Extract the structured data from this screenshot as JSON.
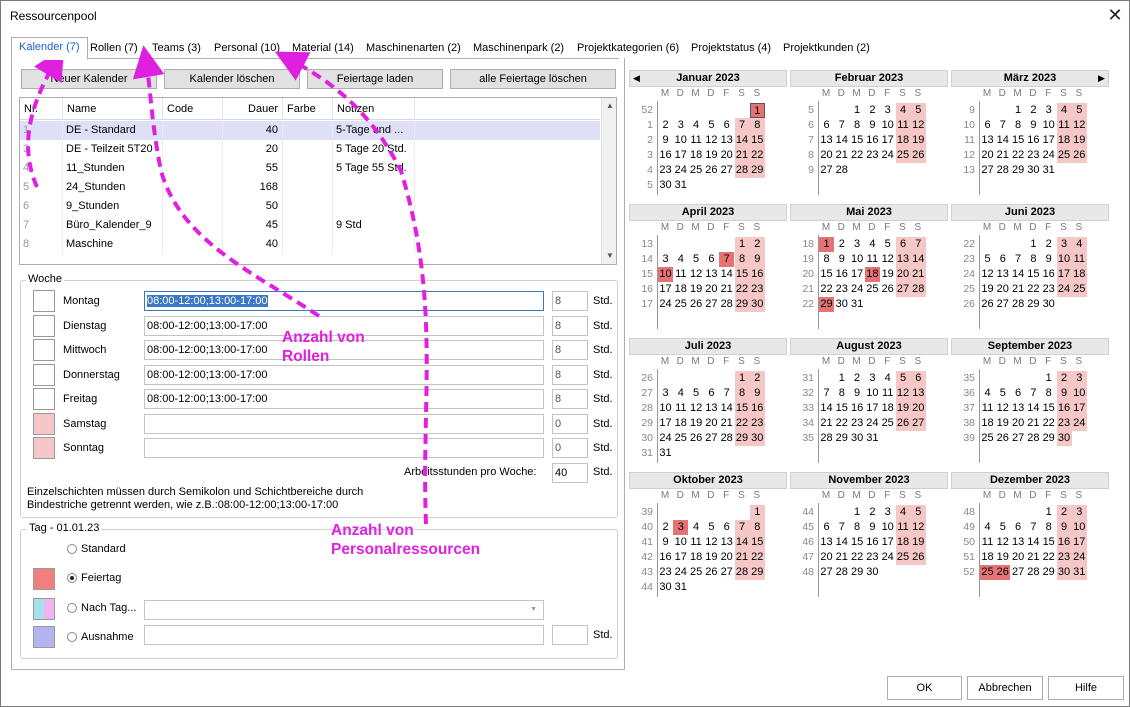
{
  "window": {
    "title": "Ressourcenpool",
    "close_glyph": "✕"
  },
  "tabs": [
    "Kalender (7)",
    "Rollen (7)",
    "Teams (3)",
    "Personal (10)",
    "Material (14)",
    "Maschinenarten (2)",
    "Maschinenpark (2)",
    "Projektkategorien (6)",
    "Projektstatus (4)",
    "Projektkunden (2)"
  ],
  "toolbar": {
    "new": "Neuer Kalender",
    "delete": "Kalender löschen",
    "load_holidays": "Feiertage laden",
    "delete_holidays": "alle Feiertage löschen"
  },
  "grid": {
    "columns": [
      "Nr.",
      "Name",
      "Code",
      "Dauer",
      "Farbe",
      "Notizen"
    ],
    "rows": [
      {
        "nr": "1",
        "name": "DE - Standard",
        "code": "",
        "dauer": "40",
        "farbe": "",
        "notizen": "5-Tage und ..."
      },
      {
        "nr": "3",
        "name": "DE - Teilzeit 5T20",
        "code": "",
        "dauer": "20",
        "farbe": "",
        "notizen": "5 Tage 20 Std."
      },
      {
        "nr": "4",
        "name": "11_Stunden",
        "code": "",
        "dauer": "55",
        "farbe": "",
        "notizen": "5 Tage 55 Std."
      },
      {
        "nr": "5",
        "name": "24_Stunden",
        "code": "",
        "dauer": "168",
        "farbe": "",
        "notizen": ""
      },
      {
        "nr": "6",
        "name": "9_Stunden",
        "code": "",
        "dauer": "50",
        "farbe": "",
        "notizen": ""
      },
      {
        "nr": "7",
        "name": "Büro_Kalender_9",
        "code": "",
        "dauer": "45",
        "farbe": "",
        "notizen": "9 Std"
      },
      {
        "nr": "8",
        "name": "Maschine",
        "code": "",
        "dauer": "40",
        "farbe": "",
        "notizen": ""
      }
    ]
  },
  "woche": {
    "title": "Woche",
    "days": [
      {
        "label": "Montag",
        "value": "08:00-12:00;13:00-17:00",
        "hours": "8",
        "color": "#ffffff"
      },
      {
        "label": "Dienstag",
        "value": "08:00-12:00;13:00-17:00",
        "hours": "8",
        "color": "#ffffff"
      },
      {
        "label": "Mittwoch",
        "value": "08:00-12:00;13:00-17:00",
        "hours": "8",
        "color": "#ffffff"
      },
      {
        "label": "Donnerstag",
        "value": "08:00-12:00;13:00-17:00",
        "hours": "8",
        "color": "#ffffff"
      },
      {
        "label": "Freitag",
        "value": "08:00-12:00;13:00-17:00",
        "hours": "8",
        "color": "#ffffff"
      },
      {
        "label": "Samstag",
        "value": "",
        "hours": "0",
        "color": "#f5c7c7"
      },
      {
        "label": "Sonntag",
        "value": "",
        "hours": "0",
        "color": "#f5c7c7"
      }
    ],
    "unit": "Std.",
    "weekly_label": "Arbeitsstunden pro Woche:",
    "weekly_value": "40",
    "hint_line1": "Einzelschichten müssen durch Semikolon und Schichtbereiche durch",
    "hint_line2": "Bindestriche getrennt werden, wie z.B.:08:00-12:00;13:00-17:00"
  },
  "tag": {
    "title": "Tag - 01.01.23",
    "options": {
      "standard": "Standard",
      "feiertag": "Feiertag",
      "nach_tag": "Nach Tag...",
      "ausnahme": "Ausnahme"
    },
    "selected": "Feiertag",
    "unit": "Std.",
    "colors": {
      "feiertag": "#f08080",
      "ausnahme": "#b4b4f0",
      "nach_tag_a": "#a8e0f0",
      "nach_tag_b": "#f0b4f0"
    }
  },
  "calendar": {
    "year": 2023,
    "day_headers": [
      "M",
      "D",
      "M",
      "D",
      "F",
      "S",
      "S"
    ],
    "months": [
      "Januar 2023",
      "Februar 2023",
      "März 2023",
      "April 2023",
      "Mai 2023",
      "Juni 2023",
      "Juli 2023",
      "August 2023",
      "September 2023",
      "Oktober 2023",
      "November 2023",
      "Dezember 2023"
    ],
    "holidays": [
      "2023-01-01",
      "2023-04-07",
      "2023-04-10",
      "2023-05-01",
      "2023-05-18",
      "2023-05-29",
      "2023-10-03",
      "2023-12-25",
      "2023-12-26"
    ],
    "weekend_color": "#f5c7c7",
    "holiday_color": "#e57373"
  },
  "annotations": {
    "rollen_line1": "Anzahl von",
    "rollen_line2": "Rollen",
    "personal_line1": "Anzahl von",
    "personal_line2": "Personalressourcen",
    "color": "#e020e0"
  },
  "footer": {
    "ok": "OK",
    "cancel": "Abbrechen",
    "help": "Hilfe"
  }
}
